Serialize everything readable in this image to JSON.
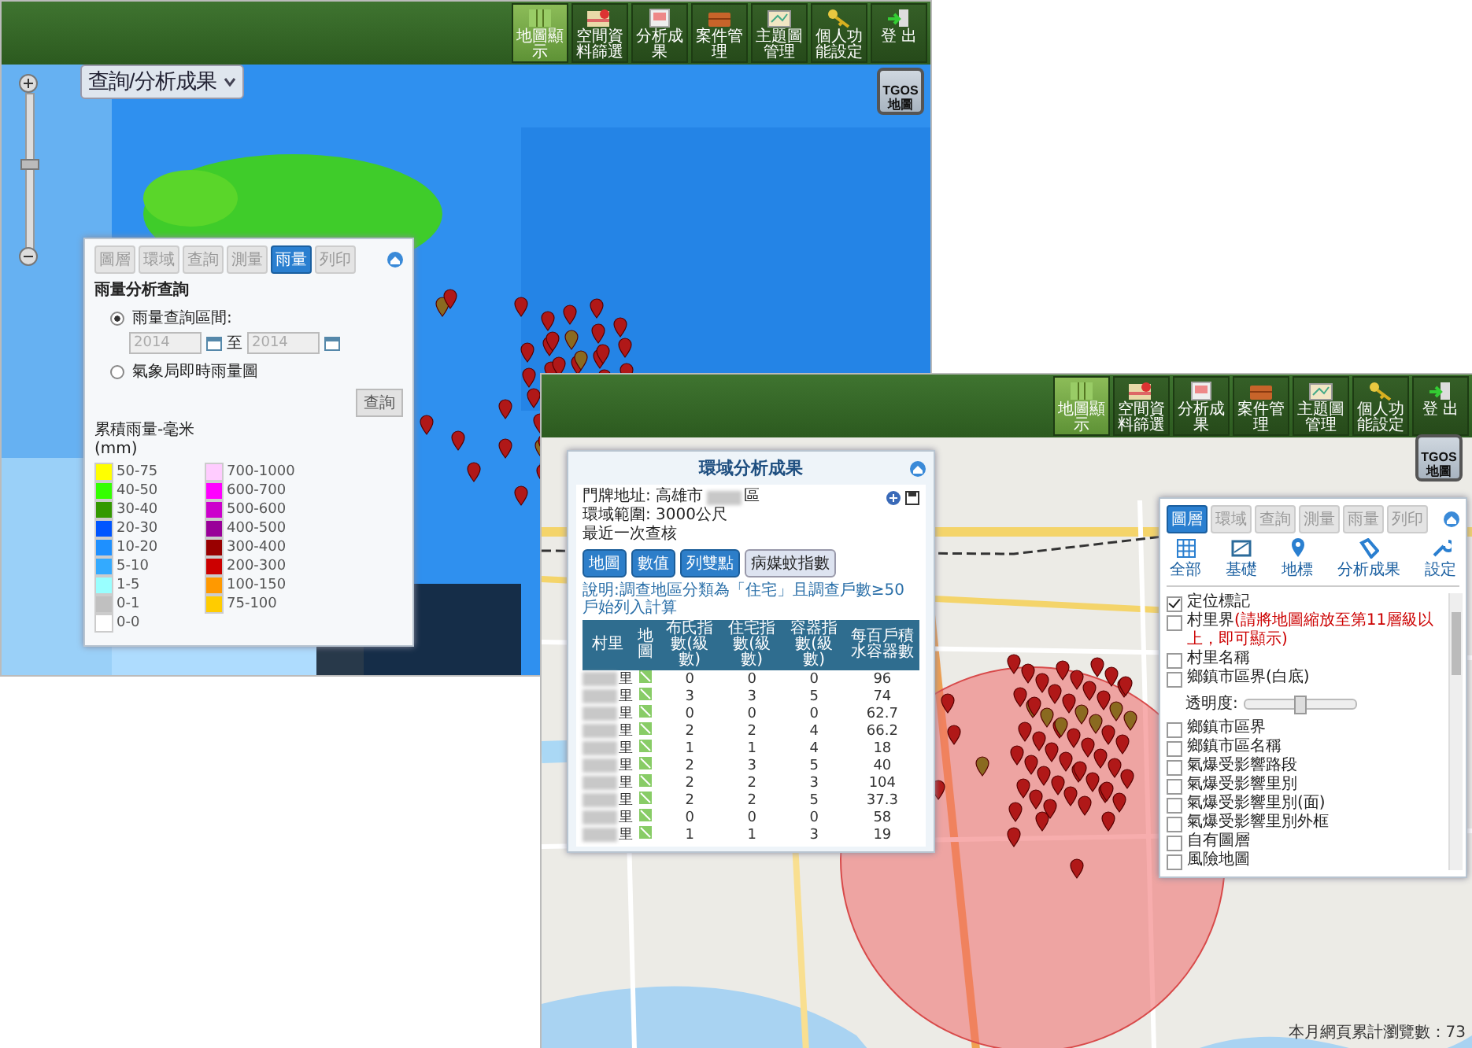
{
  "back_window": {
    "toolbar": [
      {
        "label": "地圖顯示",
        "selected": true
      },
      {
        "label": "空間資料篩選",
        "selected": false
      },
      {
        "label": "分析成果",
        "selected": false
      },
      {
        "label": "案件管理",
        "selected": false
      },
      {
        "label": "主題圖管理",
        "selected": false
      },
      {
        "label": "個人功能設定",
        "selected": false
      },
      {
        "label": "登 出",
        "selected": false
      }
    ],
    "layer_dropdown": {
      "label": "查詢/分析成果"
    },
    "zoom": {
      "level": 0.55
    },
    "map_button": "TGOS地圖",
    "rain_panel": {
      "tabs": [
        {
          "label": "圖層",
          "selected": false
        },
        {
          "label": "環域",
          "selected": false
        },
        {
          "label": "查詢",
          "selected": false
        },
        {
          "label": "測量",
          "selected": false
        },
        {
          "label": "雨量",
          "selected": true
        },
        {
          "label": "列印",
          "selected": false
        }
      ],
      "title": "雨量分析查詢",
      "options": [
        {
          "label": "雨量查詢區間:",
          "selected": true
        },
        {
          "label": "氣象局即時雨量圖",
          "selected": false
        }
      ],
      "date_from": "2014",
      "date_separator": "至",
      "date_to": "2014",
      "query_button": "查詢",
      "legend_title": "累積雨量-毫米",
      "legend_unit": "(mm)",
      "legend": [
        {
          "label": "50-75",
          "color": "#ffff00"
        },
        {
          "label": "40-50",
          "color": "#33ff00"
        },
        {
          "label": "30-40",
          "color": "#339900"
        },
        {
          "label": "20-30",
          "color": "#0055ff"
        },
        {
          "label": "10-20",
          "color": "#1e90ff"
        },
        {
          "label": "5-10",
          "color": "#33aaff"
        },
        {
          "label": "1-5",
          "color": "#99ffff"
        },
        {
          "label": "0-1",
          "color": "#c0c0c0"
        },
        {
          "label": "0-0",
          "color": "#ffffff"
        },
        {
          "label": "700-1000",
          "color": "#ffccff"
        },
        {
          "label": "600-700",
          "color": "#ff00ff"
        },
        {
          "label": "500-600",
          "color": "#cc00cc"
        },
        {
          "label": "400-500",
          "color": "#990099"
        },
        {
          "label": "300-400",
          "color": "#990000"
        },
        {
          "label": "200-300",
          "color": "#cc0000"
        },
        {
          "label": "100-150",
          "color": "#ff9900"
        },
        {
          "label": "75-100",
          "color": "#ffcc00"
        }
      ]
    }
  },
  "front_window": {
    "toolbar": [
      {
        "label": "地圖顯示",
        "selected": true
      },
      {
        "label": "空間資料篩選",
        "selected": false
      },
      {
        "label": "分析成果",
        "selected": false
      },
      {
        "label": "案件管理",
        "selected": false
      },
      {
        "label": "主題圖管理",
        "selected": false
      },
      {
        "label": "個人功能設定",
        "selected": false
      },
      {
        "label": "登 出",
        "selected": false
      }
    ],
    "map_button": "TGOS地圖",
    "analysis_panel": {
      "title": "環域分析成果",
      "address": "門牌地址: 高雄市",
      "address_end": "區",
      "range": "環域範圍: 3000公尺",
      "last_check": "最近一次查核",
      "buttons": [
        {
          "label": "地圖",
          "selected": false
        },
        {
          "label": "數值",
          "selected": false
        },
        {
          "label": "列雙點",
          "selected": false
        },
        {
          "label": "病媒蚊指數",
          "selected": true
        }
      ],
      "note": "說明:調查地區分類為「住宅」且調查戶數≥50戶始列入計算",
      "columns": [
        "村里",
        "地圖",
        "布氏指數(級數)",
        "住宅指數(級數)",
        "容器指數(級數)",
        "每百戶積水容器數"
      ],
      "rows": [
        {
          "village": "里",
          "values": [
            "0",
            "0",
            "0",
            "96"
          ]
        },
        {
          "village": "里",
          "values": [
            "3",
            "3",
            "5",
            "74"
          ]
        },
        {
          "village": "里",
          "values": [
            "0",
            "0",
            "0",
            "62.7"
          ]
        },
        {
          "village": "里",
          "values": [
            "2",
            "2",
            "4",
            "66.2"
          ]
        },
        {
          "village": "里",
          "values": [
            "1",
            "1",
            "4",
            "18"
          ]
        },
        {
          "village": "里",
          "values": [
            "2",
            "3",
            "5",
            "40"
          ]
        },
        {
          "village": "里",
          "values": [
            "2",
            "2",
            "3",
            "104"
          ]
        },
        {
          "village": "里",
          "values": [
            "2",
            "2",
            "5",
            "37.3"
          ]
        },
        {
          "village": "里",
          "values": [
            "0",
            "0",
            "0",
            "58"
          ]
        },
        {
          "village": "里",
          "values": [
            "1",
            "1",
            "3",
            "19"
          ]
        }
      ]
    },
    "layer_panel": {
      "tabs": [
        {
          "label": "圖層",
          "selected": true
        },
        {
          "label": "環域",
          "selected": false
        },
        {
          "label": "查詢",
          "selected": false
        },
        {
          "label": "測量",
          "selected": false
        },
        {
          "label": "雨量",
          "selected": false
        },
        {
          "label": "列印",
          "selected": false
        }
      ],
      "categories": [
        "全部",
        "基礎",
        "地標",
        "分析成果",
        "設定"
      ],
      "layers": [
        {
          "kind": "check",
          "label": "定位標記",
          "checked": true
        },
        {
          "kind": "check",
          "label": "村里界",
          "note": "(請將地圖縮放至第11層級以上，即可顯示)",
          "checked": false
        },
        {
          "kind": "check",
          "label": "村里名稱",
          "checked": false
        },
        {
          "kind": "check",
          "label": "鄉鎮市區界(白底)",
          "checked": false
        },
        {
          "kind": "slider",
          "label": "透明度:",
          "level": 0.5
        },
        {
          "kind": "check",
          "label": "鄉鎮市區界",
          "checked": false
        },
        {
          "kind": "check",
          "label": "鄉鎮市區名稱",
          "checked": false
        },
        {
          "kind": "check",
          "label": "氣爆受影響路段",
          "checked": false
        },
        {
          "kind": "check",
          "label": "氣爆受影響里別",
          "checked": false
        },
        {
          "kind": "check",
          "label": "氣爆受影響里別(面)",
          "checked": false
        },
        {
          "kind": "check",
          "label": "氣爆受影響里別外框",
          "checked": false
        },
        {
          "kind": "check",
          "label": "自有圖層",
          "checked": false
        },
        {
          "kind": "check",
          "label": "風險地圖",
          "checked": false
        }
      ]
    },
    "footer": "本月網頁累計瀏覽數：73"
  }
}
